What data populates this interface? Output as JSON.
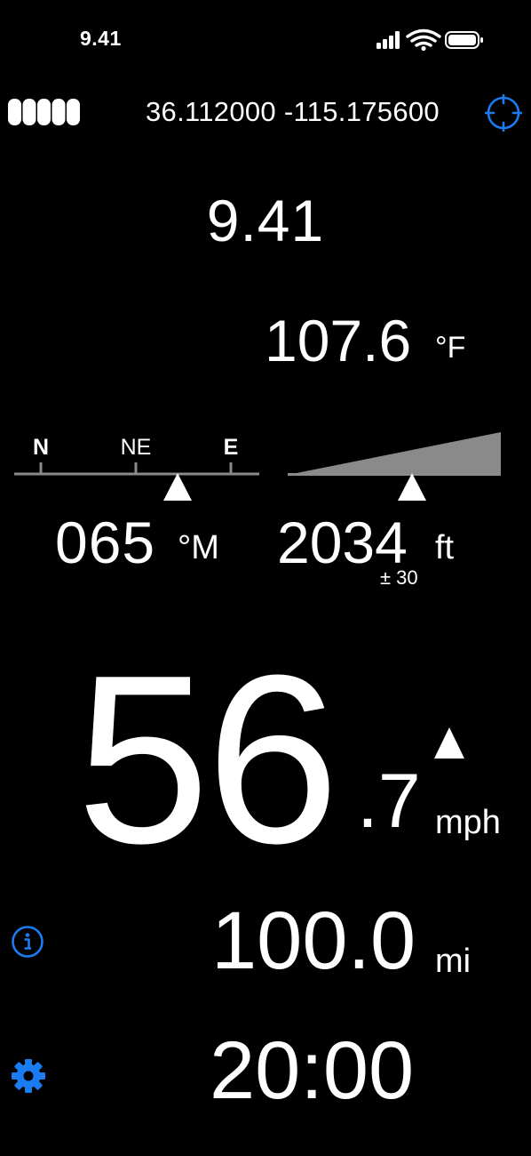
{
  "status_bar": {
    "time": "9.41",
    "icons": [
      "cellular-signal-icon",
      "wifi-icon",
      "battery-icon"
    ]
  },
  "gps": {
    "strength_icon": "gps-strength-icon",
    "strength_bars": 5,
    "coordinates": "36.112000 -115.175600",
    "locate_icon": "crosshair-icon"
  },
  "clock": {
    "time": "9.41"
  },
  "temperature": {
    "value": "107.6",
    "unit": "°F"
  },
  "compass": {
    "labels": [
      "N",
      "NE",
      "E"
    ],
    "heading": "065",
    "unit": "°M",
    "indicator_icon": "triangle-up-icon"
  },
  "altitude": {
    "value": "2034",
    "unit": "ft",
    "accuracy": "± 30",
    "indicator_icon": "triangle-up-icon"
  },
  "speed": {
    "whole": "56",
    "decimal": ".7",
    "unit": "mph",
    "trend_icon": "triangle-up-icon"
  },
  "distance": {
    "value": "100.0",
    "unit": "mi",
    "info_icon": "info-icon"
  },
  "timer": {
    "value": "20:00",
    "settings_icon": "gear-icon"
  },
  "colors": {
    "background": "#000000",
    "text": "#ffffff",
    "accent": "#1a7cf0",
    "scale_gray": "#8a8a8a"
  }
}
